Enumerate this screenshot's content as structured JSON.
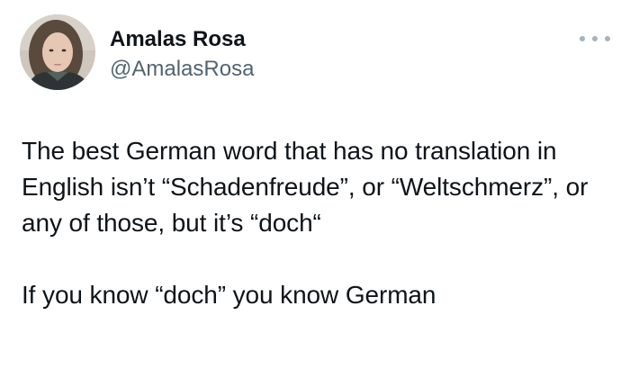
{
  "author": {
    "display_name": "Amalas Rosa",
    "handle": "@AmalasRosa",
    "avatar_icon": "profile-photo"
  },
  "menu": {
    "icon": "more-options-icon"
  },
  "tweet": {
    "paragraph_1": "The best German word that has no translation in English isn’t “Schadenfreude”, or “Weltschmerz”, or any of those, but it’s “doch“",
    "paragraph_2": "If you know “doch” you know German"
  },
  "colors": {
    "text": "#0f1419",
    "secondary": "#536471",
    "dots": "#a7b2bb"
  }
}
